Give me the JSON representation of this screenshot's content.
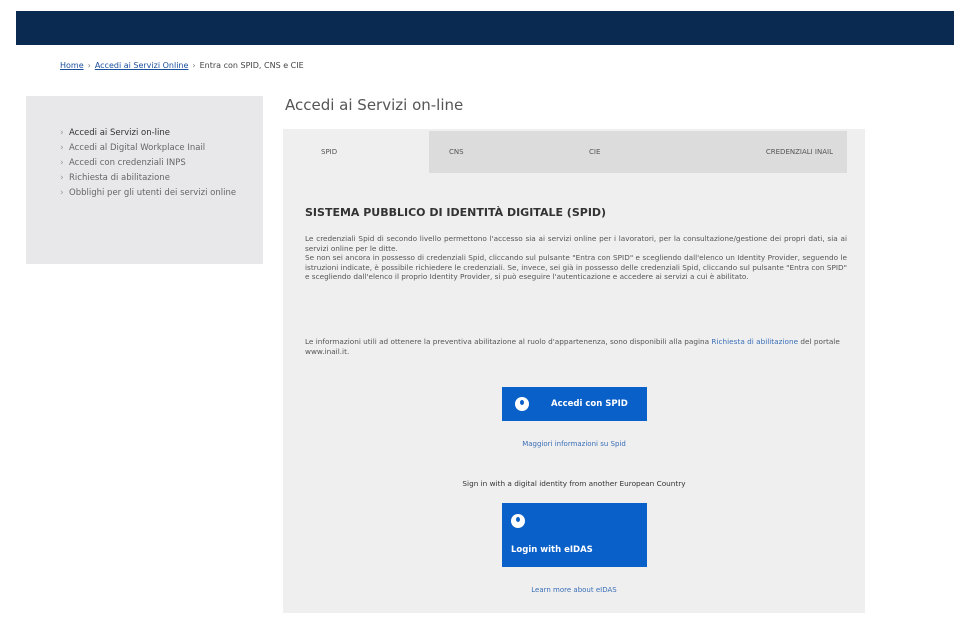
{
  "breadcrumb": {
    "home": "Home",
    "services": "Accedi ai Servizi Online",
    "current": "Entra con SPID, CNS e CIE"
  },
  "sidebar": {
    "items": [
      {
        "label": "Accedi ai Servizi on-line"
      },
      {
        "label": "Accedi al Digital Workplace Inail"
      },
      {
        "label": "Accedi con credenziali INPS"
      },
      {
        "label": "Richiesta di abilitazione"
      },
      {
        "label": "Obblighi per gli utenti dei servizi online"
      }
    ]
  },
  "page_title": "Accedi ai Servizi on-line",
  "tabs": [
    {
      "label": "SPID"
    },
    {
      "label": "CNS"
    },
    {
      "label": "CIE"
    },
    {
      "label": "CREDENZIALI INAIL"
    }
  ],
  "content": {
    "section_title": "SISTEMA PUBBLICO DI IDENTITÀ DIGITALE (SPID)",
    "desc_p1": "Le credenziali Spid di secondo livello permettono l'accesso sia ai servizi online per i lavoratori, per la consultazione/gestione dei propri dati, sia ai servizi online per le ditte.",
    "desc_p2": "Se non sei ancora in possesso di credenziali Spid, cliccando sul pulsante \"Entra con SPID\" e scegliendo dall'elenco un Identity Provider, seguendo le istruzioni indicate, è possibile richiedere le credenziali. Se, invece, sei già in possesso delle credenziali Spid, cliccando sul pulsante \"Entra con SPID\" e scegliendo dall'elenco il proprio Identity Provider, si può eseguire l'autenticazione e accedere ai servizi a cui è abilitato.",
    "info_text": "Le informazioni utili ad ottenere la preventiva abilitazione al ruolo d'appartenenza, sono disponibili alla pagina",
    "info_link": "Richiesta di abilitazione",
    "info_suffix": "del portale www.inail.it.",
    "spid_button": "Accedi con SPID",
    "spid_more": "Maggiori informazioni su Spid",
    "eidas_intro": "Sign in with a digital identity from another European Country",
    "eidas_button": "Login with eIDAS",
    "eidas_more": "Learn more about eIDAS"
  },
  "colors": {
    "topbar": "#0b2a52",
    "primary_button": "#0a60c9",
    "link": "#3a6fb8",
    "sidebar_bg": "#e8e8eb",
    "panel_bg": "#efefef"
  }
}
